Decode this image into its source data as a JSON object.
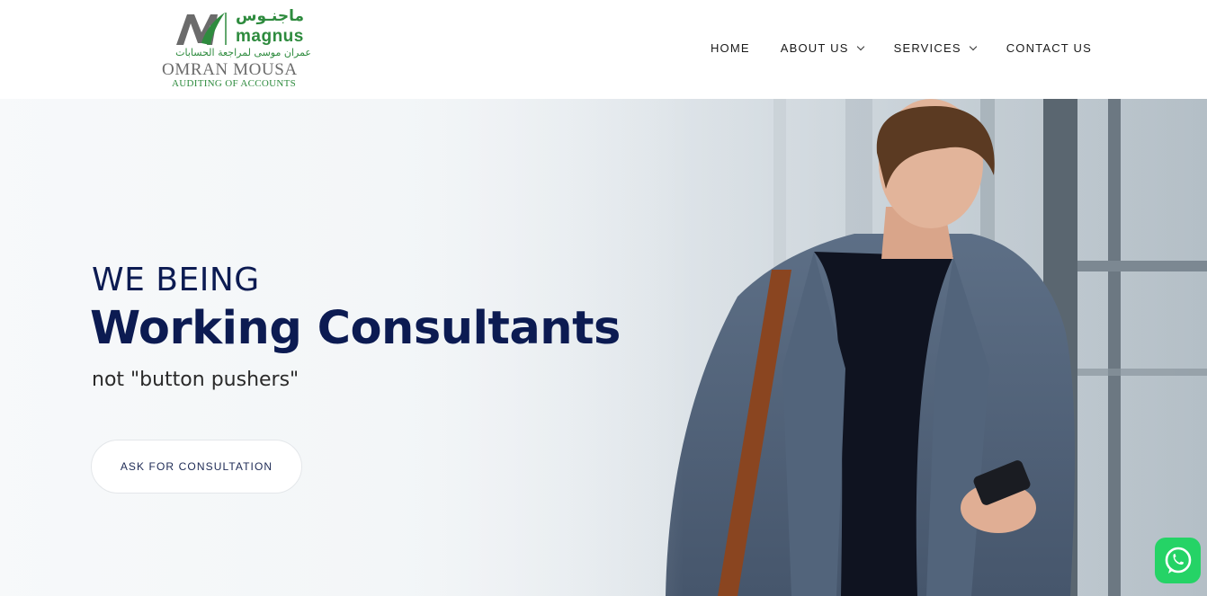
{
  "brand": {
    "arabic_name": "ماجنـوس",
    "english_mark": "magnus",
    "arabic_subtitle": "عمران موسى لمراجعة الحسابات",
    "name": "OMRAN MOUSA",
    "tagline": "AUDITING OF ACCOUNTS",
    "colors": {
      "green": "#2e8b3e",
      "grey": "#6b6b6b"
    }
  },
  "nav": {
    "items": [
      {
        "label": "HOME",
        "has_dropdown": false
      },
      {
        "label": "ABOUT US",
        "has_dropdown": true,
        "icon": "chevron-down-icon"
      },
      {
        "label": "SERVICES",
        "has_dropdown": true,
        "icon": "chevron-down-icon"
      },
      {
        "label": "CONTACT US",
        "has_dropdown": false
      }
    ]
  },
  "hero": {
    "line1": "WE BEING",
    "line2": "Working Consultants",
    "line3": "not \"button pushers\"",
    "cta_label": "ASK FOR CONSULTATION",
    "colors": {
      "heading": "#0c1b52"
    }
  },
  "floating": {
    "whatsapp_icon": "whatsapp-icon",
    "color": "#25d366"
  }
}
